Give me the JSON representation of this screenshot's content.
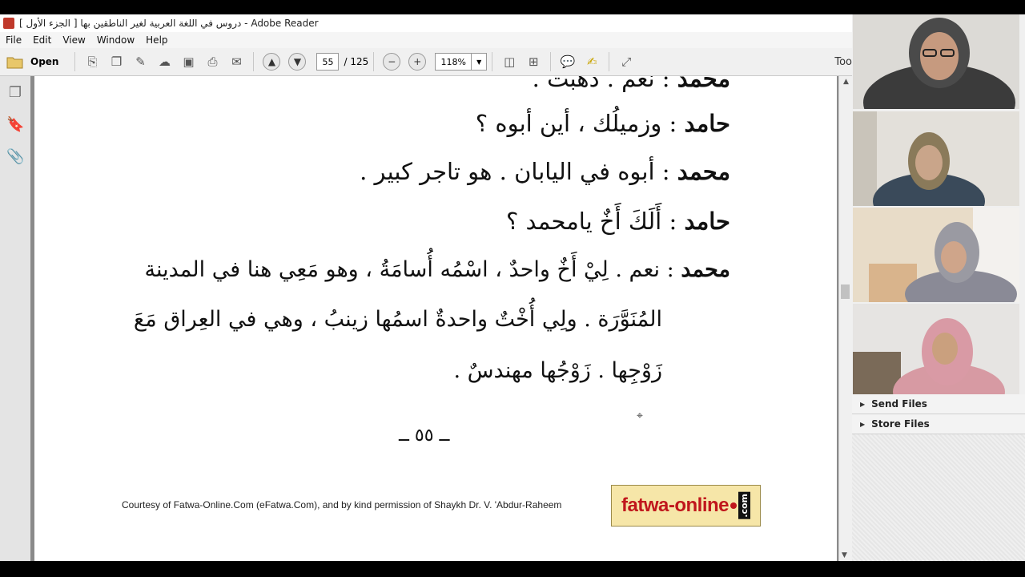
{
  "window": {
    "title": "دروس في اللغة العربية لغير الناطقين بها [ الجزء الأول ] - Adobe Reader"
  },
  "menu": [
    "File",
    "Edit",
    "View",
    "Window",
    "Help"
  ],
  "toolbar": {
    "open_label": "Open",
    "page_current": "55",
    "page_total": "/ 125",
    "zoom": "118%",
    "tools_label": "Too"
  },
  "document": {
    "lines": [
      {
        "speaker": "محمد",
        "text": "نعم . ذهبت ."
      },
      {
        "speaker": "حامد",
        "text": "وزميلُك ، أين أبوه ؟"
      },
      {
        "speaker": "محمد",
        "text": "أبوه في اليابان . هو تاجر كبير ."
      },
      {
        "speaker": "حامد",
        "text": "أَلَكَ أَخٌ يامحمد ؟"
      },
      {
        "speaker": "محمد",
        "text": "نعم . لِيْ أَخٌ واحدٌ ، اسْمُه أُسامَةُ ، وهو مَعِي هنا في المدينة"
      },
      {
        "speaker": "",
        "text": "المُنَوَّرَة . ولِي أُخْتٌ واحدةٌ اسمُها زينبُ ، وهي في العِراق مَعَ"
      },
      {
        "speaker": "",
        "text": "زَوْجِها . زَوْجُها مهندسٌ ."
      }
    ],
    "page_number": "ــ ٥٥ ــ",
    "footer": "Courtesy of Fatwa-Online.Com (eFatwa.Com), and by kind permission of Shaykh Dr. V. 'Abdur-Raheem",
    "logo_text": "fatwa-online",
    "logo_suffix": ".com"
  },
  "side_panel": {
    "items": [
      "Send Files",
      "Store Files"
    ]
  },
  "colors": {
    "logo_red": "#c0161c",
    "logo_bg": "#f6e6a8"
  }
}
